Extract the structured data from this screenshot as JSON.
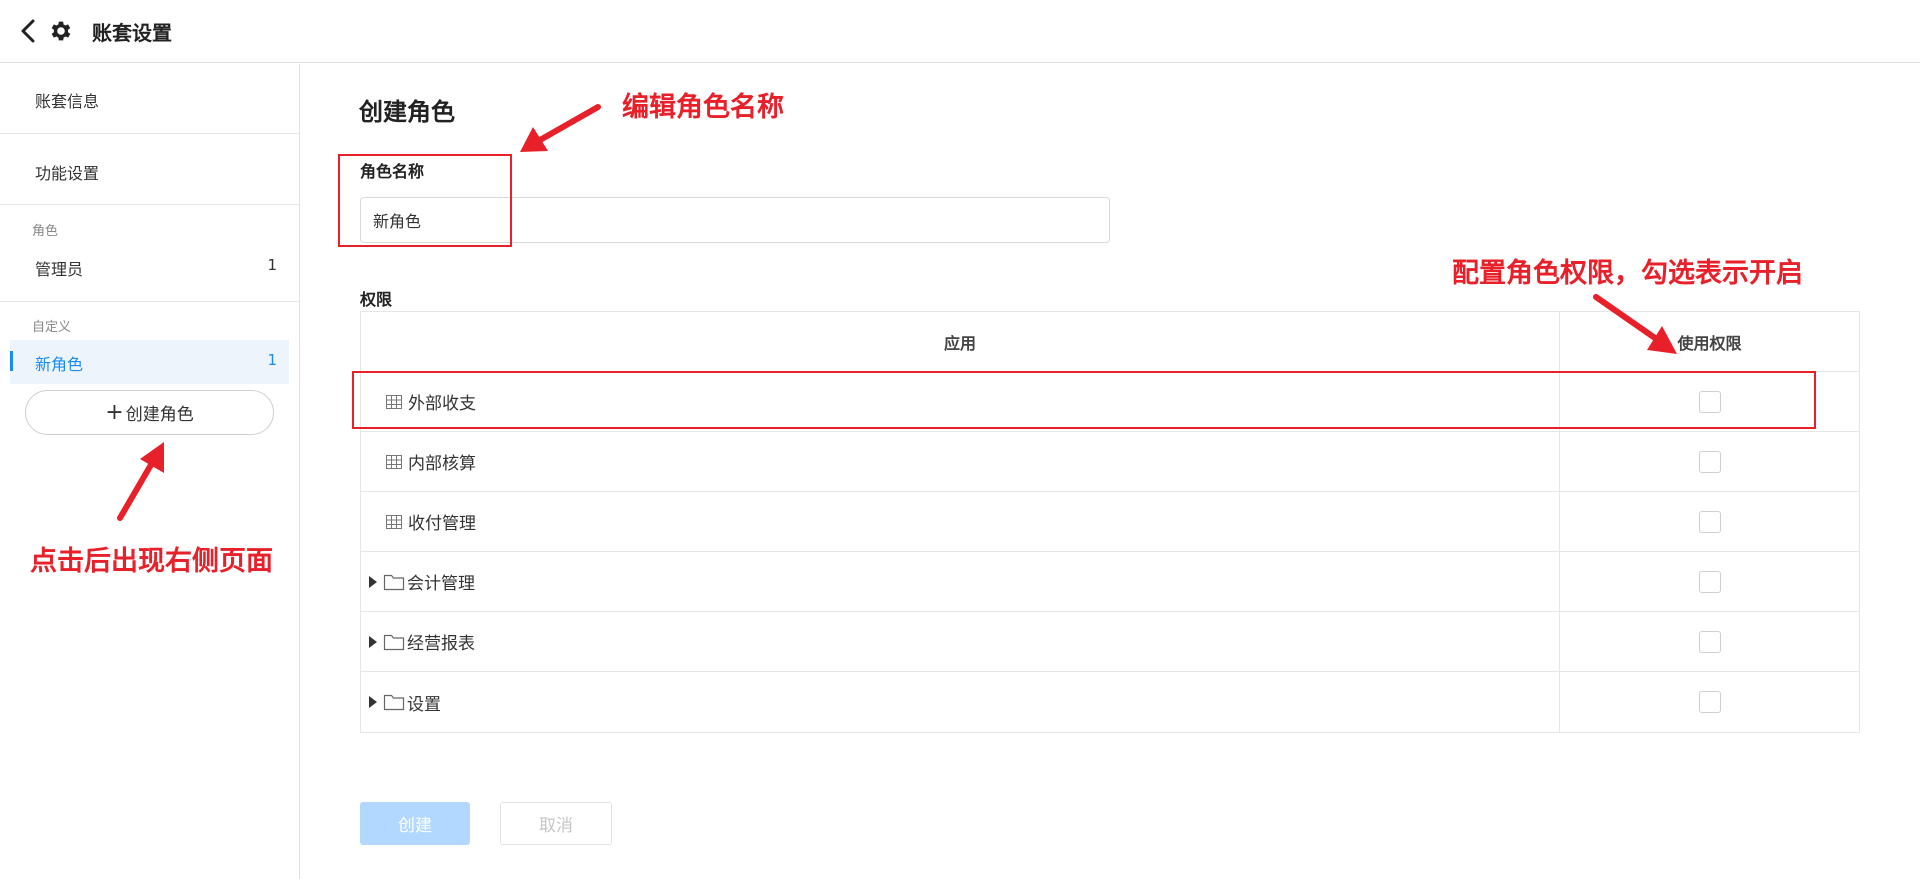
{
  "header": {
    "title": "账套设置",
    "back_icon": "chevron-left-icon",
    "settings_icon": "gear-icon"
  },
  "sidebar": {
    "account_info": "账套信息",
    "feature_settings": "功能设置",
    "roles_group": "角色",
    "admin": {
      "label": "管理员",
      "count": "1"
    },
    "custom_group": "自定义",
    "new_role": {
      "label": "新角色",
      "count": "1"
    },
    "create_role": {
      "plus": "+",
      "label": "创建角色"
    },
    "active_color": "#1a8cf0"
  },
  "main": {
    "heading": "创建角色",
    "role_name_label": "角色名称",
    "role_name_value": "新角色",
    "permissions_label": "权限",
    "table": {
      "headers": {
        "app": "应用",
        "perm": "使用权限"
      },
      "rows": [
        {
          "label": "外部收支",
          "kind": "grid",
          "checked": false
        },
        {
          "label": "内部核算",
          "kind": "grid",
          "checked": false
        },
        {
          "label": "收付管理",
          "kind": "grid",
          "checked": false
        },
        {
          "label": "会计管理",
          "kind": "folder",
          "checked": false
        },
        {
          "label": "经营报表",
          "kind": "folder",
          "checked": false
        },
        {
          "label": "设置",
          "kind": "folder",
          "checked": false
        }
      ]
    },
    "buttons": {
      "create": "创建",
      "cancel": "取消"
    }
  },
  "annotations": {
    "edit_name": "编辑角色名称",
    "configure_perm": "配置角色权限，勾选表示开启",
    "click_hint": "点击后出现右侧页面",
    "color": "#e8202a"
  }
}
